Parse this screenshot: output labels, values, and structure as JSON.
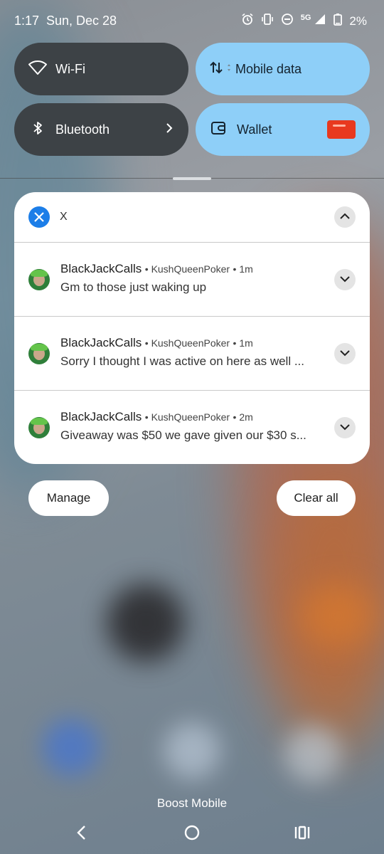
{
  "status_bar": {
    "time": "1:17",
    "date": "Sun, Dec 28",
    "network": "5G",
    "battery": "2%"
  },
  "quick_tiles": [
    {
      "label": "Wi-Fi",
      "icon": "wifi-icon",
      "active": false
    },
    {
      "label": "Mobile data",
      "icon": "mobile-data-icon",
      "active": true
    },
    {
      "label": "Bluetooth",
      "icon": "bluetooth-icon",
      "active": false
    },
    {
      "label": "Wallet",
      "icon": "wallet-icon",
      "active": true
    }
  ],
  "notification_group": {
    "app_name": "X",
    "notifications": [
      {
        "sender": "BlackJackCalls",
        "account": "KushQueenPoker",
        "time": "1m",
        "text": "Gm to those just waking up"
      },
      {
        "sender": "BlackJackCalls",
        "account": "KushQueenPoker",
        "time": "1m",
        "text": "Sorry I thought I was active on here as well ..."
      },
      {
        "sender": "BlackJackCalls",
        "account": "KushQueenPoker",
        "time": "2m",
        "text": "Giveaway was $50 we gave given our $30 s..."
      }
    ]
  },
  "actions": {
    "manage": "Manage",
    "clear_all": "Clear all"
  },
  "carrier": "Boost Mobile",
  "colors": {
    "tile_active": "#8ecff8",
    "tile_inactive": "#3d4246",
    "x_badge": "#1c7ee8"
  }
}
